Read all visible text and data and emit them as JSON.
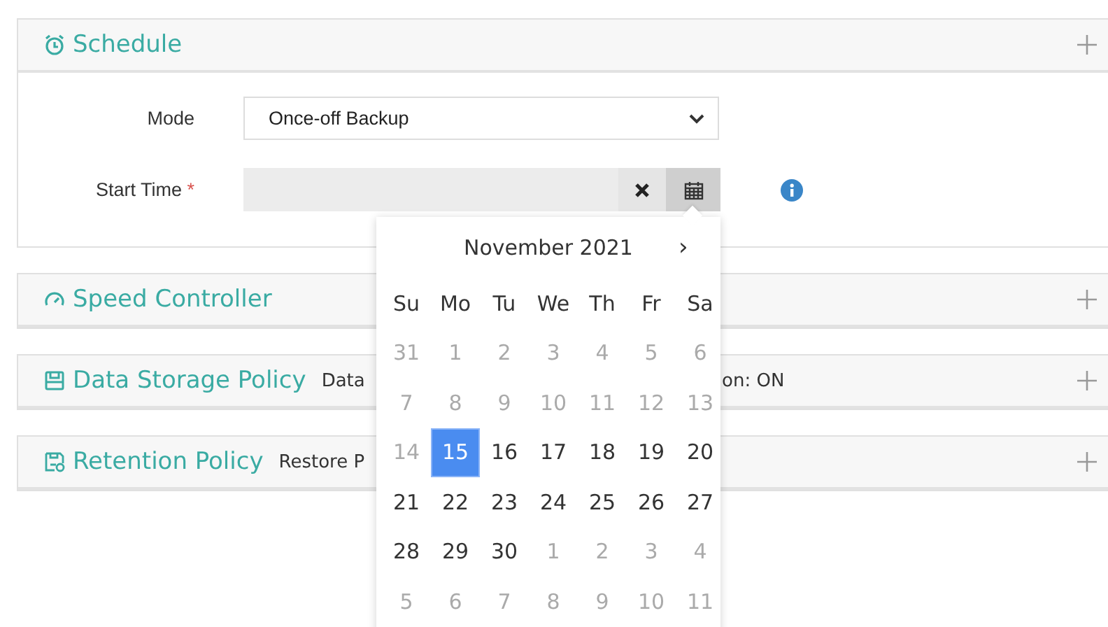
{
  "schedule": {
    "title": "Schedule",
    "expanded": true,
    "mode": {
      "label": "Mode",
      "value": "Once-off Backup"
    },
    "start_time": {
      "label": "Start Time",
      "required_mark": "*"
    }
  },
  "calendar": {
    "month": "November 2021",
    "next": "›",
    "weekdays": [
      "Su",
      "Mo",
      "Tu",
      "We",
      "Th",
      "Fr",
      "Sa"
    ],
    "weeks": [
      [
        {
          "day": "31",
          "muted": true,
          "selected": false
        },
        {
          "day": "1",
          "muted": true,
          "selected": false
        },
        {
          "day": "2",
          "muted": true,
          "selected": false
        },
        {
          "day": "3",
          "muted": true,
          "selected": false
        },
        {
          "day": "4",
          "muted": true,
          "selected": false
        },
        {
          "day": "5",
          "muted": true,
          "selected": false
        },
        {
          "day": "6",
          "muted": true,
          "selected": false
        }
      ],
      [
        {
          "day": "7",
          "muted": true,
          "selected": false
        },
        {
          "day": "8",
          "muted": true,
          "selected": false
        },
        {
          "day": "9",
          "muted": true,
          "selected": false
        },
        {
          "day": "10",
          "muted": true,
          "selected": false
        },
        {
          "day": "11",
          "muted": true,
          "selected": false
        },
        {
          "day": "12",
          "muted": true,
          "selected": false
        },
        {
          "day": "13",
          "muted": true,
          "selected": false
        }
      ],
      [
        {
          "day": "14",
          "muted": true,
          "selected": false
        },
        {
          "day": "15",
          "muted": false,
          "selected": true
        },
        {
          "day": "16",
          "muted": false,
          "selected": false
        },
        {
          "day": "17",
          "muted": false,
          "selected": false
        },
        {
          "day": "18",
          "muted": false,
          "selected": false
        },
        {
          "day": "19",
          "muted": false,
          "selected": false
        },
        {
          "day": "20",
          "muted": false,
          "selected": false
        }
      ],
      [
        {
          "day": "21",
          "muted": false,
          "selected": false
        },
        {
          "day": "22",
          "muted": false,
          "selected": false
        },
        {
          "day": "23",
          "muted": false,
          "selected": false
        },
        {
          "day": "24",
          "muted": false,
          "selected": false
        },
        {
          "day": "25",
          "muted": false,
          "selected": false
        },
        {
          "day": "26",
          "muted": false,
          "selected": false
        },
        {
          "day": "27",
          "muted": false,
          "selected": false
        }
      ],
      [
        {
          "day": "28",
          "muted": false,
          "selected": false
        },
        {
          "day": "29",
          "muted": false,
          "selected": false
        },
        {
          "day": "30",
          "muted": false,
          "selected": false
        },
        {
          "day": "1",
          "muted": true,
          "selected": false
        },
        {
          "day": "2",
          "muted": true,
          "selected": false
        },
        {
          "day": "3",
          "muted": true,
          "selected": false
        },
        {
          "day": "4",
          "muted": true,
          "selected": false
        }
      ],
      [
        {
          "day": "5",
          "muted": true,
          "selected": false
        },
        {
          "day": "6",
          "muted": true,
          "selected": false
        },
        {
          "day": "7",
          "muted": true,
          "selected": false
        },
        {
          "day": "8",
          "muted": true,
          "selected": false
        },
        {
          "day": "9",
          "muted": true,
          "selected": false
        },
        {
          "day": "10",
          "muted": true,
          "selected": false
        },
        {
          "day": "11",
          "muted": true,
          "selected": false
        }
      ]
    ]
  },
  "panels": [
    {
      "kind": "speed",
      "title": "Speed Controller",
      "expanded": false
    },
    {
      "kind": "storage",
      "title": "Data Storage Policy",
      "expanded": false,
      "summary": "Data",
      "summary_tail": "on: ON"
    },
    {
      "kind": "retention",
      "title": "Retention Policy",
      "expanded": false,
      "summary": "Restore P"
    }
  ]
}
